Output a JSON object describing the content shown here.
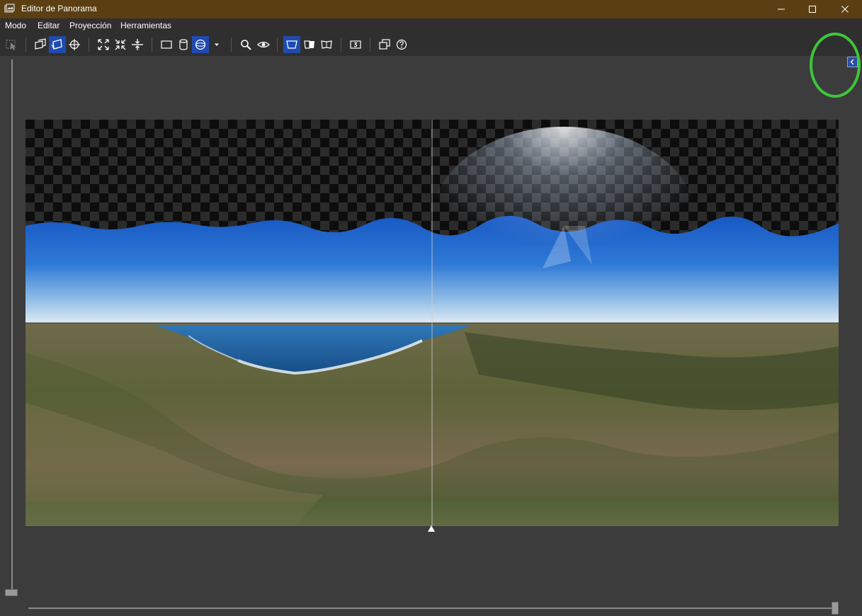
{
  "window": {
    "title": "Editor de Panorama"
  },
  "menu": [
    "Modo",
    "Editar",
    "Proyección",
    "Herramientas"
  ],
  "toolbar": {
    "tools": [
      {
        "name": "select-tool",
        "active": false
      },
      {
        "name": "preview-tool",
        "active": false
      },
      {
        "name": "drag-tool",
        "active": true
      },
      {
        "name": "center-tool",
        "active": false
      },
      {
        "name": "fit-tool",
        "active": false
      },
      {
        "name": "shrink-tool",
        "active": false
      },
      {
        "name": "straighten-tool",
        "active": false
      },
      {
        "name": "rectilinear-projection",
        "active": false
      },
      {
        "name": "cylindrical-projection",
        "active": false
      },
      {
        "name": "spherical-projection",
        "active": true
      },
      {
        "name": "projection-dropdown",
        "active": false
      },
      {
        "name": "zoom-tool",
        "active": false
      },
      {
        "name": "view-tool",
        "active": false
      },
      {
        "name": "layout-full",
        "active": true
      },
      {
        "name": "layout-half",
        "active": false
      },
      {
        "name": "layout-open",
        "active": false
      },
      {
        "name": "three-d-tool",
        "active": false
      },
      {
        "name": "windows-tool",
        "active": false
      },
      {
        "name": "help-tool",
        "active": false
      }
    ]
  },
  "accents": {
    "titlebar": "#5b3f13",
    "active_tool": "#1f4bb0",
    "highlight": "#3ec63a"
  }
}
